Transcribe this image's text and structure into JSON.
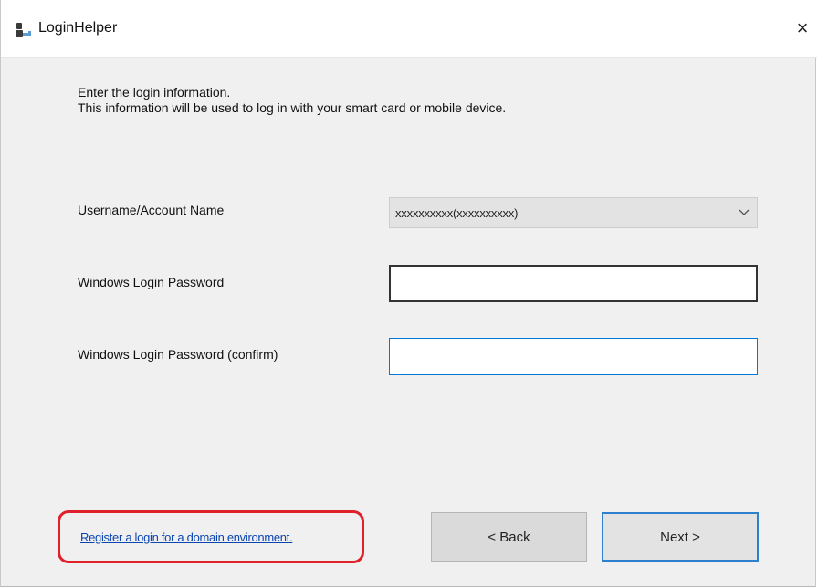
{
  "window": {
    "title": "LoginHelper",
    "close_glyph": "×",
    "icon": "user-key-icon"
  },
  "instructions": {
    "line1": "Enter the login information.",
    "line2": "This information will be used to log in with your smart card or mobile device."
  },
  "fields": {
    "username_label": "Username/Account Name",
    "username_value": "xxxxxxxxxx(xxxxxxxxxx)",
    "password_label": "Windows Login Password",
    "password_value": "",
    "confirm_label": "Windows Login Password (confirm)",
    "confirm_value": ""
  },
  "footer": {
    "domain_link": "Register a login for a domain environment.",
    "back_label": "< Back",
    "next_label": "Next >"
  },
  "colors": {
    "highlight_outline": "#e0202a",
    "link": "#0b45b0",
    "focus_border": "#0078d7"
  }
}
